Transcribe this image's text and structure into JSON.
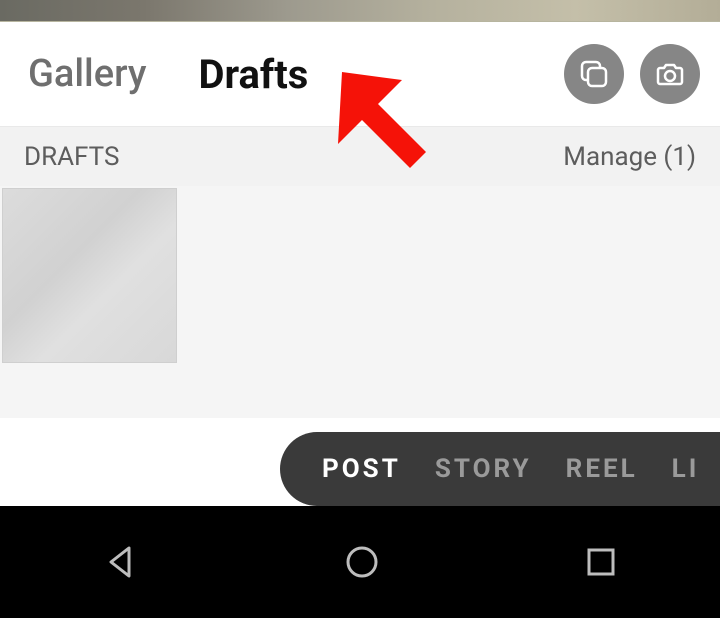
{
  "source_tabs": {
    "gallery": "Gallery",
    "drafts": "Drafts"
  },
  "section": {
    "title": "DRAFTS",
    "manage_label": "Manage (1)"
  },
  "modes": {
    "post": "POST",
    "story": "STORY",
    "reel": "REEL",
    "live": "LI"
  },
  "drafts_count": 1
}
